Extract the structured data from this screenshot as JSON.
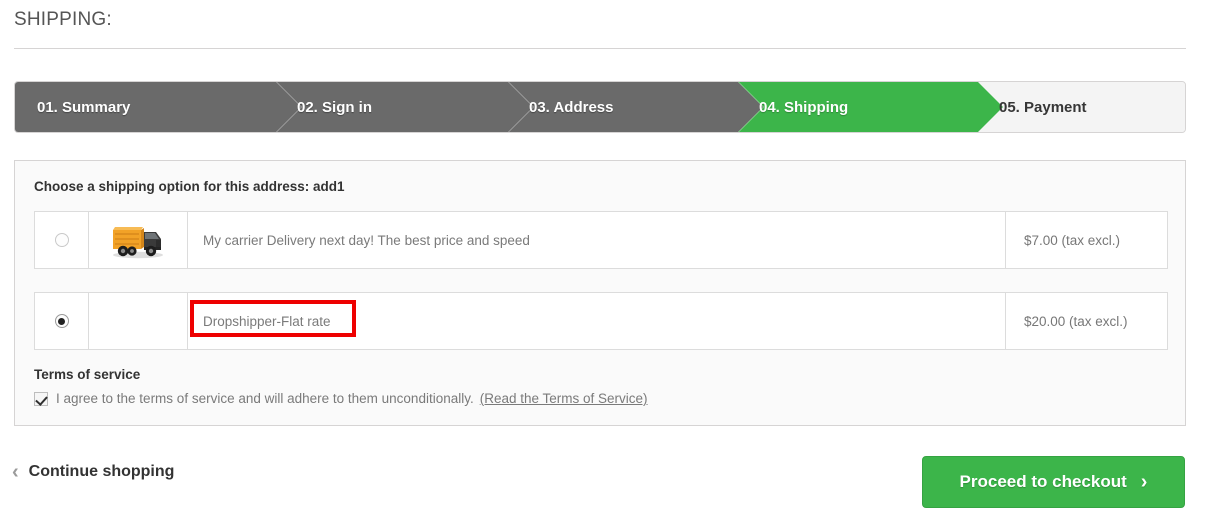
{
  "header": {
    "title": "SHIPPING:"
  },
  "steps": [
    {
      "label": "01. Summary",
      "state": "done"
    },
    {
      "label": "02. Sign in",
      "state": "done"
    },
    {
      "label": "03. Address",
      "state": "done"
    },
    {
      "label": "04. Shipping",
      "state": "current"
    },
    {
      "label": "05. Payment",
      "state": "todo"
    }
  ],
  "panel": {
    "title": "Choose a shipping option for this address: add1",
    "options": [
      {
        "selected": false,
        "logo": "delivery-truck-icon",
        "name": "My carrier Delivery next day! The best price and speed",
        "price": "$7.00 (tax excl.)"
      },
      {
        "selected": true,
        "logo": "none",
        "name": "Dropshipper-Flat rate",
        "price": "$20.00 (tax excl.)"
      }
    ],
    "terms": {
      "title": "Terms of service",
      "checked": true,
      "agreement_text": "I agree to the terms of service and will adhere to them unconditionally.",
      "link_label": "(Read the Terms of Service)"
    }
  },
  "footer": {
    "continue_shopping": "Continue shopping",
    "checkout": "Proceed to checkout"
  },
  "colors": {
    "accent_green": "#3cb54a",
    "step_done_gray": "#6a6a6a",
    "step_todo_gray": "#f4f4f4",
    "annotation_red": "#ee0000"
  },
  "icons": {
    "chevron_left": "‹",
    "chevron_right": "›"
  }
}
